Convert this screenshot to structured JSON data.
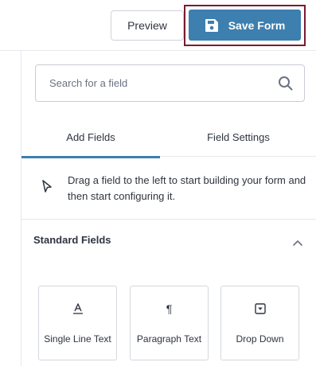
{
  "toolbar": {
    "preview_label": "Preview",
    "save_label": "Save Form"
  },
  "search": {
    "placeholder": "Search for a field",
    "value": ""
  },
  "tabs": [
    {
      "label": "Add Fields",
      "active": true
    },
    {
      "label": "Field Settings",
      "active": false
    }
  ],
  "hint": {
    "text": "Drag a field to the left to start building your form and then start configuring it."
  },
  "section": {
    "title": "Standard Fields",
    "expanded": true
  },
  "fields": [
    {
      "label": "Single Line Text",
      "icon": "single-line-text-icon"
    },
    {
      "label": "Paragraph Text",
      "icon": "paragraph-icon",
      "glyph": "¶"
    },
    {
      "label": "Drop Down",
      "icon": "dropdown-icon"
    }
  ],
  "colors": {
    "accent": "#3d7fae",
    "highlight_outline": "#7a1b30",
    "border": "#e6e8ec"
  }
}
